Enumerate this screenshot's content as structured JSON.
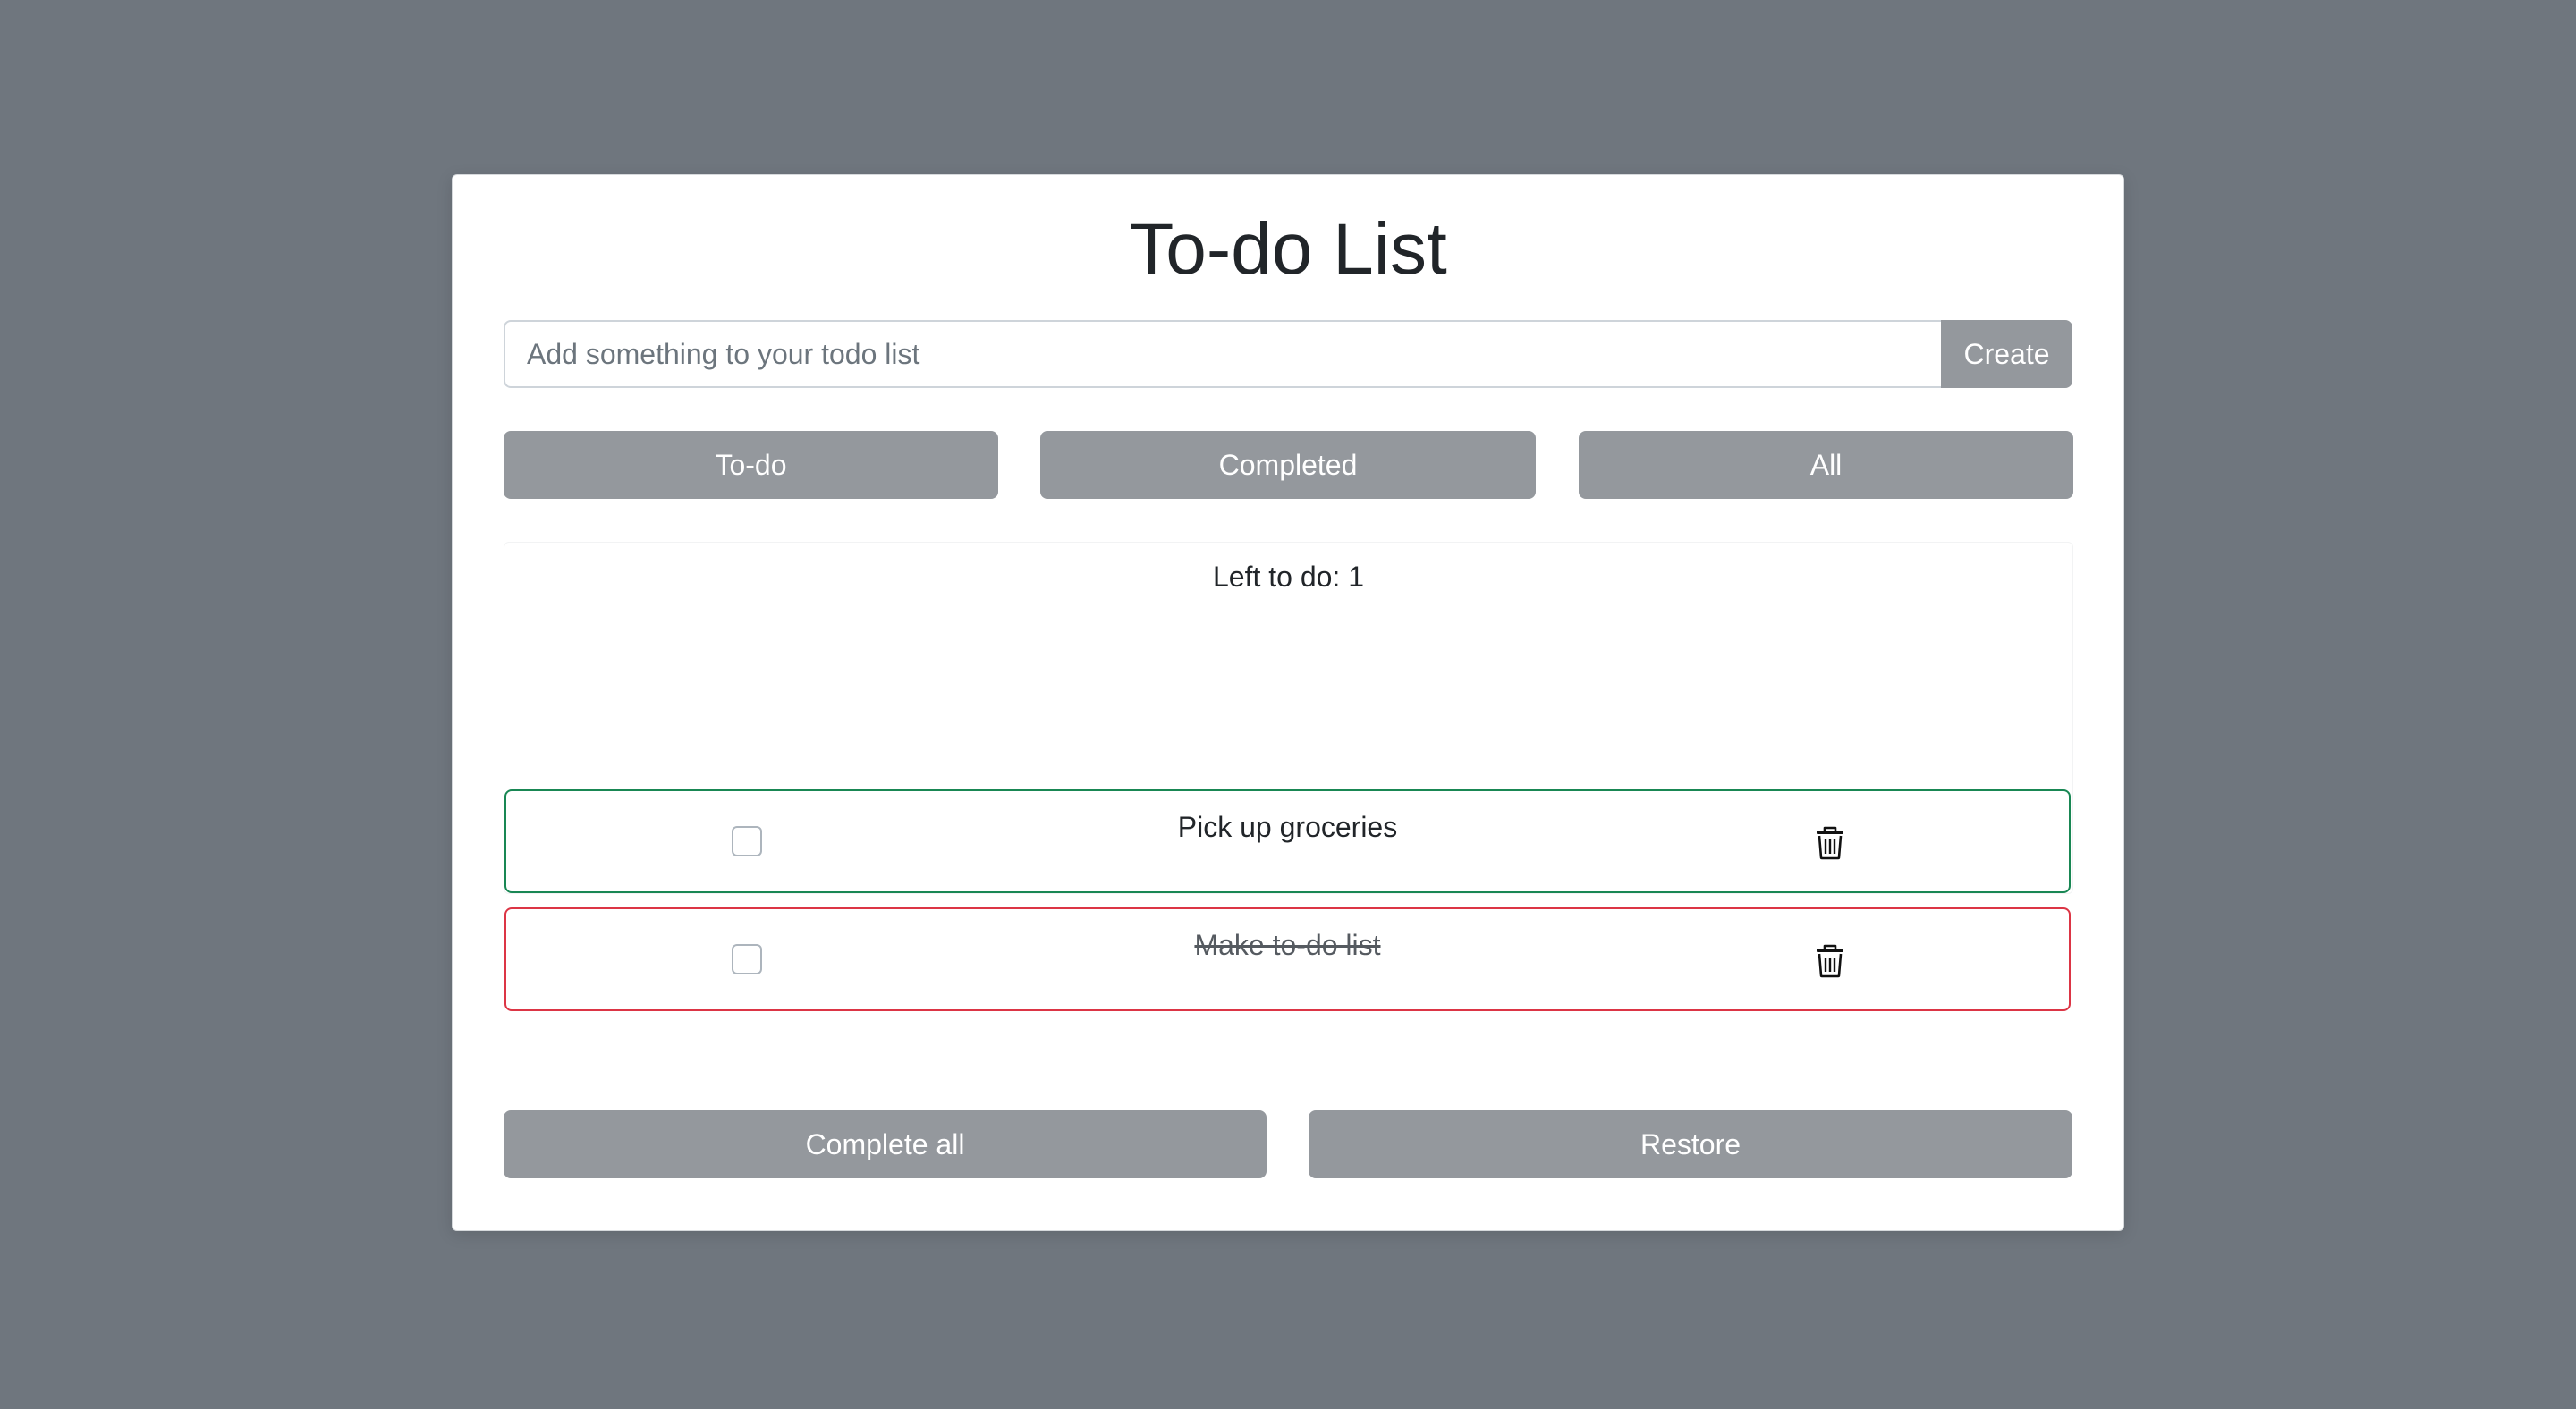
{
  "app": {
    "title": "To-do List"
  },
  "add_form": {
    "input_value": "",
    "input_placeholder": "Add something to your todo list",
    "create_label": "Create"
  },
  "filters": {
    "todo_label": "To-do",
    "completed_label": "Completed",
    "all_label": "All"
  },
  "summary": {
    "left_to_do_text": "Left to do: 1"
  },
  "todos": [
    {
      "text": "Pick up groceries",
      "completed": false,
      "border_color": "#198754"
    },
    {
      "text": "Make to-do list",
      "completed": true,
      "border_color": "#dc3545"
    }
  ],
  "icons": {
    "delete": "trash-icon",
    "checkbox": "checkbox-icon"
  },
  "actions": {
    "complete_all_label": "Complete all",
    "restore_label": "Restore"
  },
  "colors": {
    "background": "#6f767e",
    "card": "#ffffff",
    "button": "#94989d",
    "active_border": "#198754",
    "completed_border": "#dc3545",
    "text": "#212529"
  }
}
